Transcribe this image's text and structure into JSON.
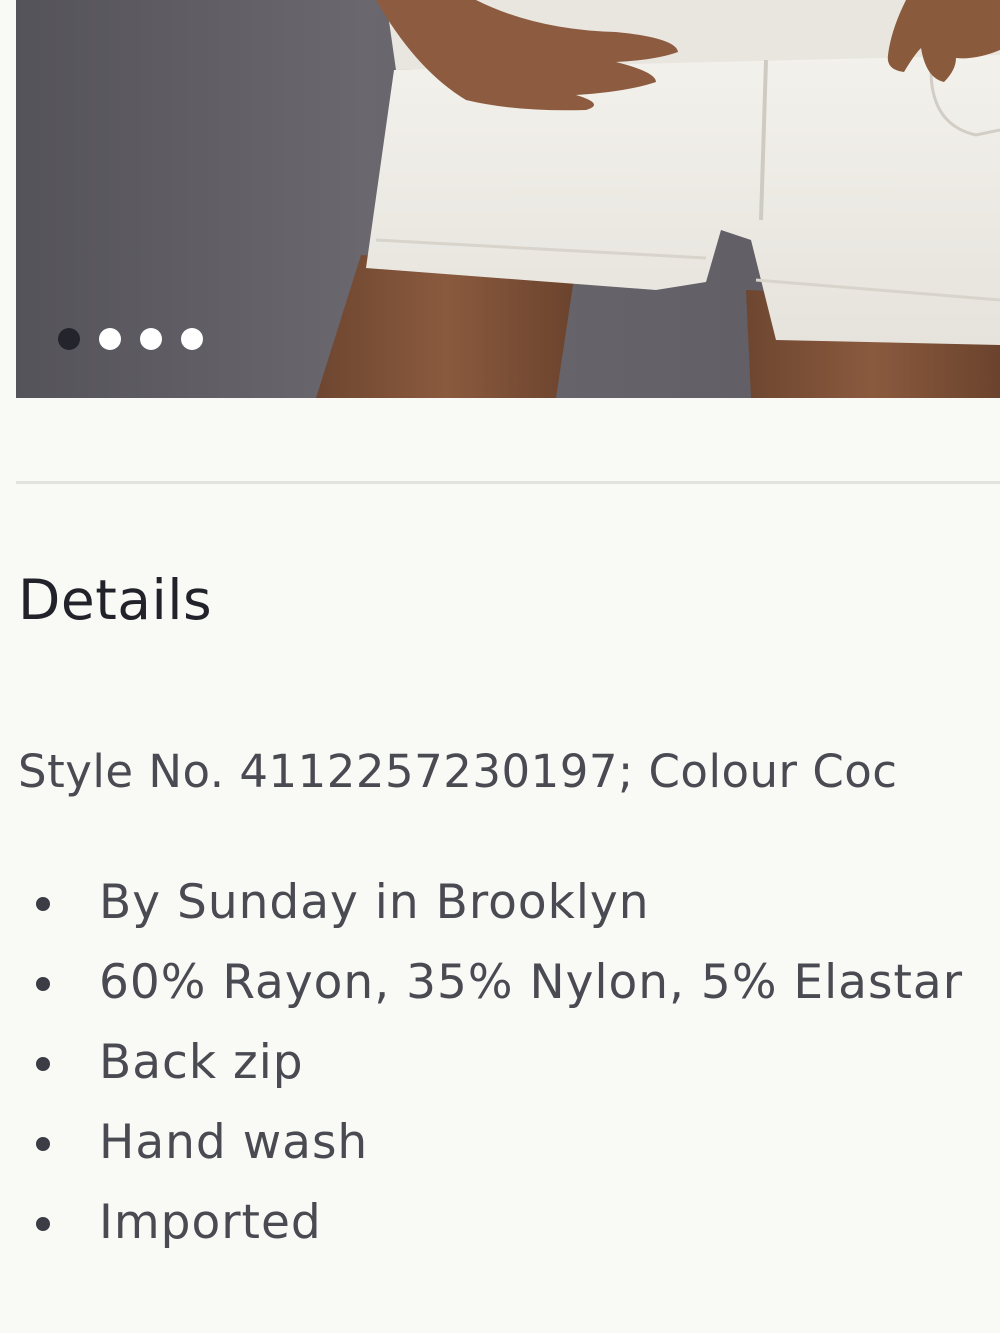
{
  "carousel": {
    "slide_count": 4,
    "active_index": 0,
    "dot_active_color": "#24242c",
    "dot_inactive_color": "#ffffff"
  },
  "details": {
    "title": "Details",
    "style_line": "Style No. 4112257230197; Colour Coc",
    "items": [
      "By Sunday in Brooklyn",
      "60% Rayon, 35% Nylon, 5% Elastar",
      "Back zip",
      "Hand wash",
      "Imported"
    ]
  },
  "colors": {
    "background": "#f9f9f6",
    "divider": "#e2e2de",
    "text_primary": "#22222a",
    "text_secondary": "#4a4a52"
  }
}
